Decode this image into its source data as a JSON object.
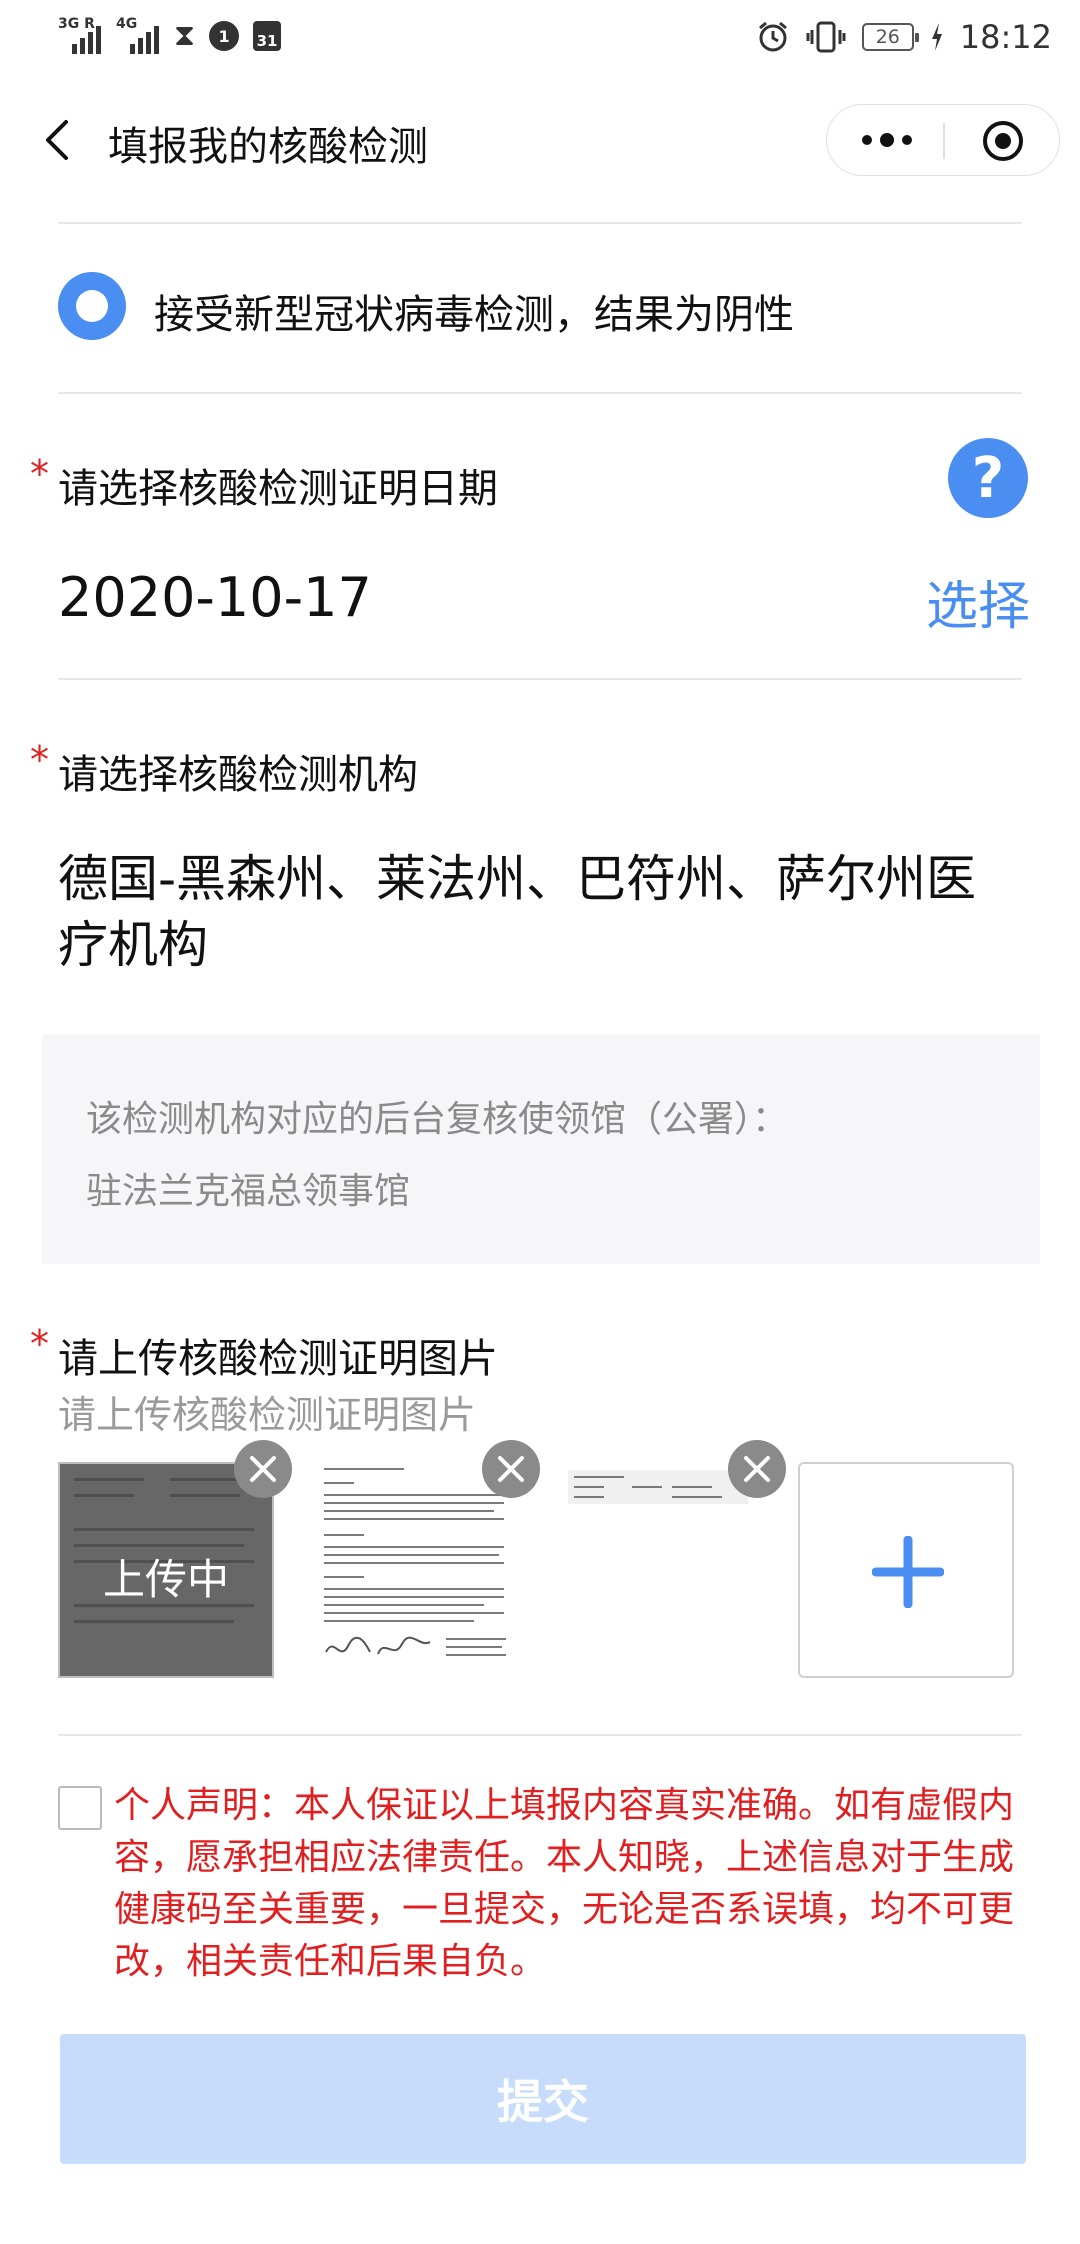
{
  "status_bar": {
    "network_1": "3G R",
    "network_2": "4G",
    "badge_number": "1",
    "calendar_day": "31",
    "battery_level": "26",
    "time": "18:12"
  },
  "nav": {
    "title": "填报我的核酸检测"
  },
  "test_result": {
    "option_label": "接受新型冠状病毒检测，结果为阴性",
    "selected": true
  },
  "date_section": {
    "required_mark": "*",
    "label": "请选择核酸检测证明日期",
    "help_symbol": "?",
    "value": "2020-10-17",
    "select_label": "选择"
  },
  "org_section": {
    "required_mark": "*",
    "label": "请选择核酸检测机构",
    "value": "德国-黑森州、莱法州、巴符州、萨尔州医疗机构",
    "info_line_1": "该检测机构对应的后台复核使领馆（公署）：",
    "info_line_2": "驻法兰克福总领事馆"
  },
  "upload_section": {
    "required_mark": "*",
    "label": "请上传核酸检测证明图片",
    "hint": "请上传核酸检测证明图片",
    "uploading_text": "上传中"
  },
  "declaration": {
    "checked": false,
    "text": "个人声明：本人保证以上填报内容真实准确。如有虚假内容，愿承担相应法律责任。本人知晓，上述信息对于生成健康码至关重要，一旦提交，无论是否系误填，均不可更改，相关责任和后果自负。"
  },
  "submit": {
    "label": "提交",
    "enabled": false
  },
  "colors": {
    "accent": "#4a8ef2",
    "required": "#e02020",
    "submit_disabled": "#c7dcfa"
  }
}
